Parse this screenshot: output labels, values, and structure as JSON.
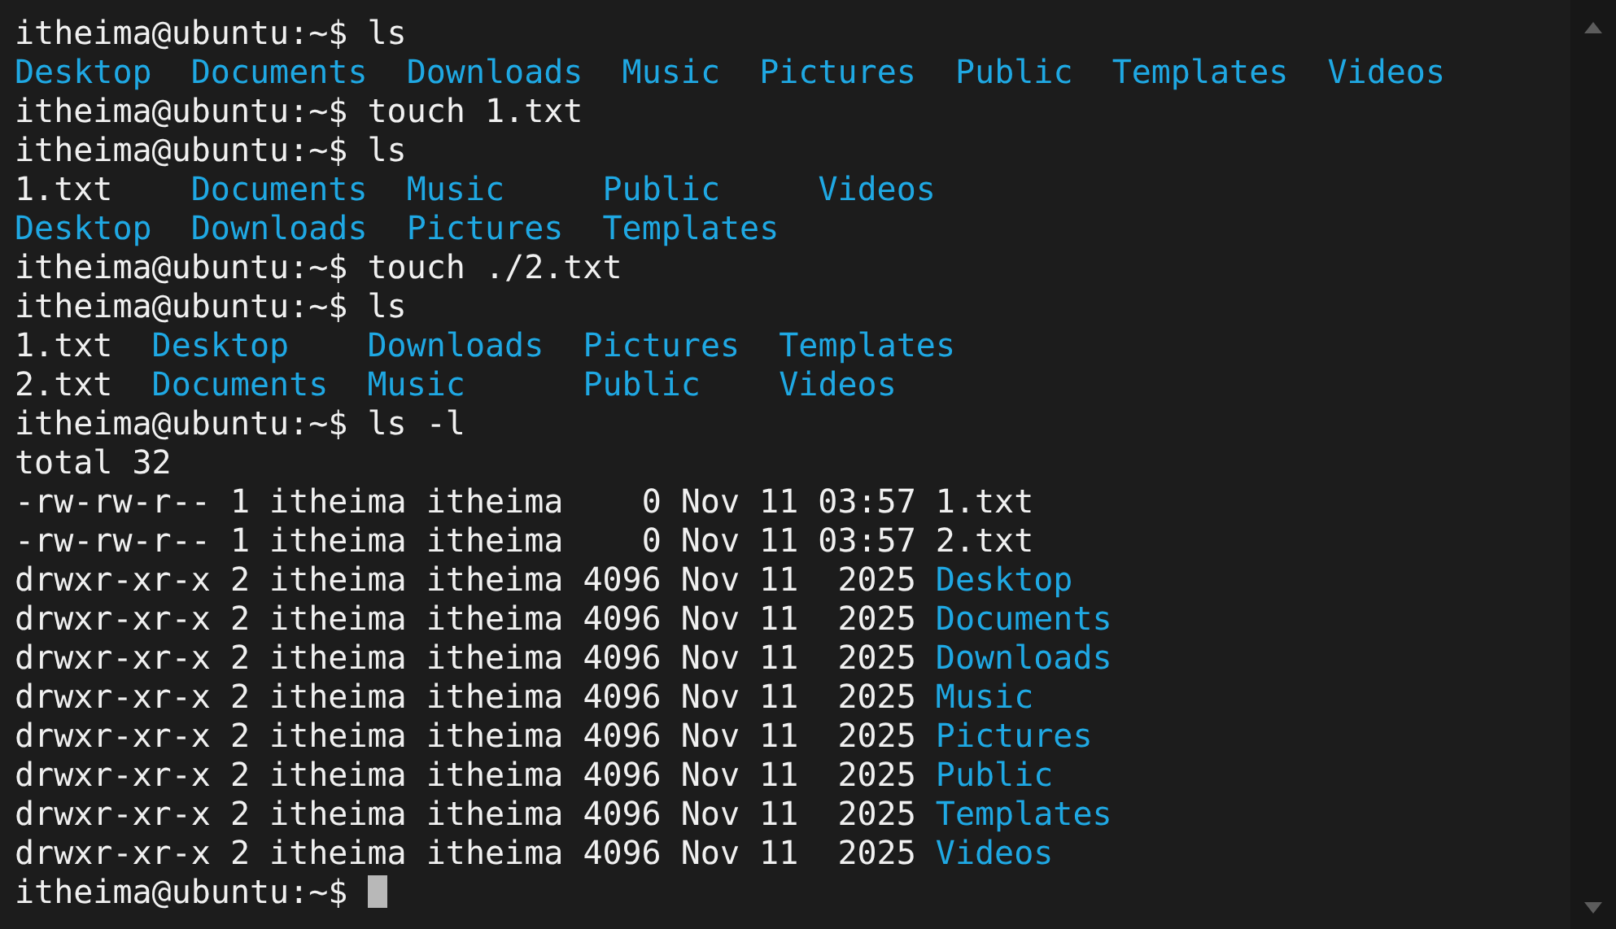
{
  "terminal": {
    "blocks": [
      {
        "kind": "prompt",
        "prompt": "itheima@ubuntu:~$",
        "command": "ls",
        "cursor": false
      },
      {
        "kind": "grid",
        "rows": [
          [
            {
              "name": "Desktop",
              "directory": true
            },
            {
              "name": "Documents",
              "directory": true
            },
            {
              "name": "Downloads",
              "directory": true
            },
            {
              "name": "Music",
              "directory": true
            },
            {
              "name": "Pictures",
              "directory": true
            },
            {
              "name": "Public",
              "directory": true
            },
            {
              "name": "Templates",
              "directory": true
            },
            {
              "name": "Videos",
              "directory": true
            }
          ]
        ]
      },
      {
        "kind": "prompt",
        "prompt": "itheima@ubuntu:~$",
        "command": "touch 1.txt",
        "cursor": false
      },
      {
        "kind": "prompt",
        "prompt": "itheima@ubuntu:~$",
        "command": "ls",
        "cursor": false
      },
      {
        "kind": "grid",
        "rows": [
          [
            {
              "name": "1.txt",
              "directory": false
            },
            {
              "name": "Documents",
              "directory": true
            },
            {
              "name": "Music",
              "directory": true
            },
            {
              "name": "Public",
              "directory": true
            },
            {
              "name": "Videos",
              "directory": true
            }
          ],
          [
            {
              "name": "Desktop",
              "directory": true
            },
            {
              "name": "Downloads",
              "directory": true
            },
            {
              "name": "Pictures",
              "directory": true
            },
            {
              "name": "Templates",
              "directory": true
            }
          ]
        ]
      },
      {
        "kind": "prompt",
        "prompt": "itheima@ubuntu:~$",
        "command": "touch ./2.txt",
        "cursor": false
      },
      {
        "kind": "prompt",
        "prompt": "itheima@ubuntu:~$",
        "command": "ls",
        "cursor": false
      },
      {
        "kind": "grid",
        "rows": [
          [
            {
              "name": "1.txt",
              "directory": false
            },
            {
              "name": "Desktop",
              "directory": true
            },
            {
              "name": "Downloads",
              "directory": true
            },
            {
              "name": "Pictures",
              "directory": true
            },
            {
              "name": "Templates",
              "directory": true
            }
          ],
          [
            {
              "name": "2.txt",
              "directory": false
            },
            {
              "name": "Documents",
              "directory": true
            },
            {
              "name": "Music",
              "directory": true
            },
            {
              "name": "Public",
              "directory": true
            },
            {
              "name": "Videos",
              "directory": true
            }
          ]
        ]
      },
      {
        "kind": "prompt",
        "prompt": "itheima@ubuntu:~$",
        "command": "ls -l",
        "cursor": false
      },
      {
        "kind": "long",
        "total": "total 32",
        "entries": [
          {
            "perms": "-rw-rw-r--",
            "links": "1",
            "owner": "itheima",
            "group": "itheima",
            "size": "0",
            "month": "Nov",
            "day": "11",
            "time": "03:57",
            "name": "1.txt",
            "directory": false
          },
          {
            "perms": "-rw-rw-r--",
            "links": "1",
            "owner": "itheima",
            "group": "itheima",
            "size": "0",
            "month": "Nov",
            "day": "11",
            "time": "03:57",
            "name": "2.txt",
            "directory": false
          },
          {
            "perms": "drwxr-xr-x",
            "links": "2",
            "owner": "itheima",
            "group": "itheima",
            "size": "4096",
            "month": "Nov",
            "day": "11",
            "time": "2025",
            "name": "Desktop",
            "directory": true
          },
          {
            "perms": "drwxr-xr-x",
            "links": "2",
            "owner": "itheima",
            "group": "itheima",
            "size": "4096",
            "month": "Nov",
            "day": "11",
            "time": "2025",
            "name": "Documents",
            "directory": true
          },
          {
            "perms": "drwxr-xr-x",
            "links": "2",
            "owner": "itheima",
            "group": "itheima",
            "size": "4096",
            "month": "Nov",
            "day": "11",
            "time": "2025",
            "name": "Downloads",
            "directory": true
          },
          {
            "perms": "drwxr-xr-x",
            "links": "2",
            "owner": "itheima",
            "group": "itheima",
            "size": "4096",
            "month": "Nov",
            "day": "11",
            "time": "2025",
            "name": "Music",
            "directory": true
          },
          {
            "perms": "drwxr-xr-x",
            "links": "2",
            "owner": "itheima",
            "group": "itheima",
            "size": "4096",
            "month": "Nov",
            "day": "11",
            "time": "2025",
            "name": "Pictures",
            "directory": true
          },
          {
            "perms": "drwxr-xr-x",
            "links": "2",
            "owner": "itheima",
            "group": "itheima",
            "size": "4096",
            "month": "Nov",
            "day": "11",
            "time": "2025",
            "name": "Public",
            "directory": true
          },
          {
            "perms": "drwxr-xr-x",
            "links": "2",
            "owner": "itheima",
            "group": "itheima",
            "size": "4096",
            "month": "Nov",
            "day": "11",
            "time": "2025",
            "name": "Templates",
            "directory": true
          },
          {
            "perms": "drwxr-xr-x",
            "links": "2",
            "owner": "itheima",
            "group": "itheima",
            "size": "4096",
            "month": "Nov",
            "day": "11",
            "time": "2025",
            "name": "Videos",
            "directory": true
          }
        ]
      },
      {
        "kind": "prompt",
        "prompt": "itheima@ubuntu:~$",
        "cursor": true
      }
    ]
  }
}
